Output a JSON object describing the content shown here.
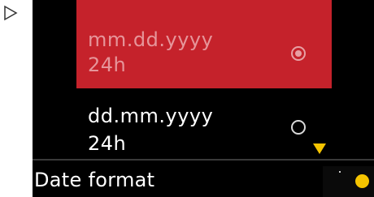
{
  "options": [
    {
      "line1": "mm.dd.yyyy",
      "line2": "24h",
      "selected": true
    },
    {
      "line1": "dd.mm.yyyy",
      "line2": "24h",
      "selected": false
    }
  ],
  "footer": {
    "title": "Date format"
  },
  "icons": {
    "play": "play-outline-icon",
    "radio_selected": "radio-selected-icon",
    "radio_unselected": "radio-unselected-icon",
    "scroll_down": "scroll-down-arrow-icon",
    "status": "status-dot-icon"
  },
  "colors": {
    "background": "#000000",
    "selected_row": "#c5222b",
    "selected_text": "#e6959a",
    "text": "#ffffff",
    "accent": "#f5c400"
  }
}
